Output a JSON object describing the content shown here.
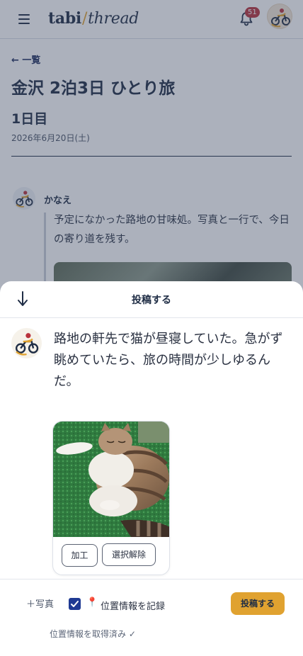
{
  "header": {
    "logo_bold": "tabi",
    "logo_slash": "/",
    "logo_italic": "thread",
    "notification_count": "51",
    "icons": {
      "menu": "menu-icon",
      "bell": "bell-icon",
      "avatar": "motorcycle-avatar"
    }
  },
  "page": {
    "back_link": "← 一覧",
    "trip_title": "金沢 2泊3日 ひとり旅",
    "day_title": "1日目",
    "date": "2026年6月20日(土)",
    "post": {
      "author": "かなえ",
      "text": "予定になかった路地の甘味処。写真と一行で、今日の寄り道を残す。"
    }
  },
  "sheet": {
    "close_icon": "arrow-down-icon",
    "title": "投稿する",
    "compose_text": "路地の軒先で猫が昼寝していた。急がず眺めていたら、旅の時間が少しゆるんだ。",
    "attachment": {
      "image": "cat-napping-photo",
      "edit_label": "加工",
      "remove_label": "選択解除"
    },
    "footer": {
      "add_photo_label": "＋写真",
      "record_location_checked": true,
      "pin_icon": "📍",
      "record_location_label": "位置情報を記録",
      "submit_label": "投稿する",
      "location_status": "位置情報を取得済み ✓"
    }
  },
  "colors": {
    "accent": "#e0a230",
    "navy": "#1f2d45",
    "badge": "#b8323d",
    "checkbox": "#1f3a93"
  }
}
